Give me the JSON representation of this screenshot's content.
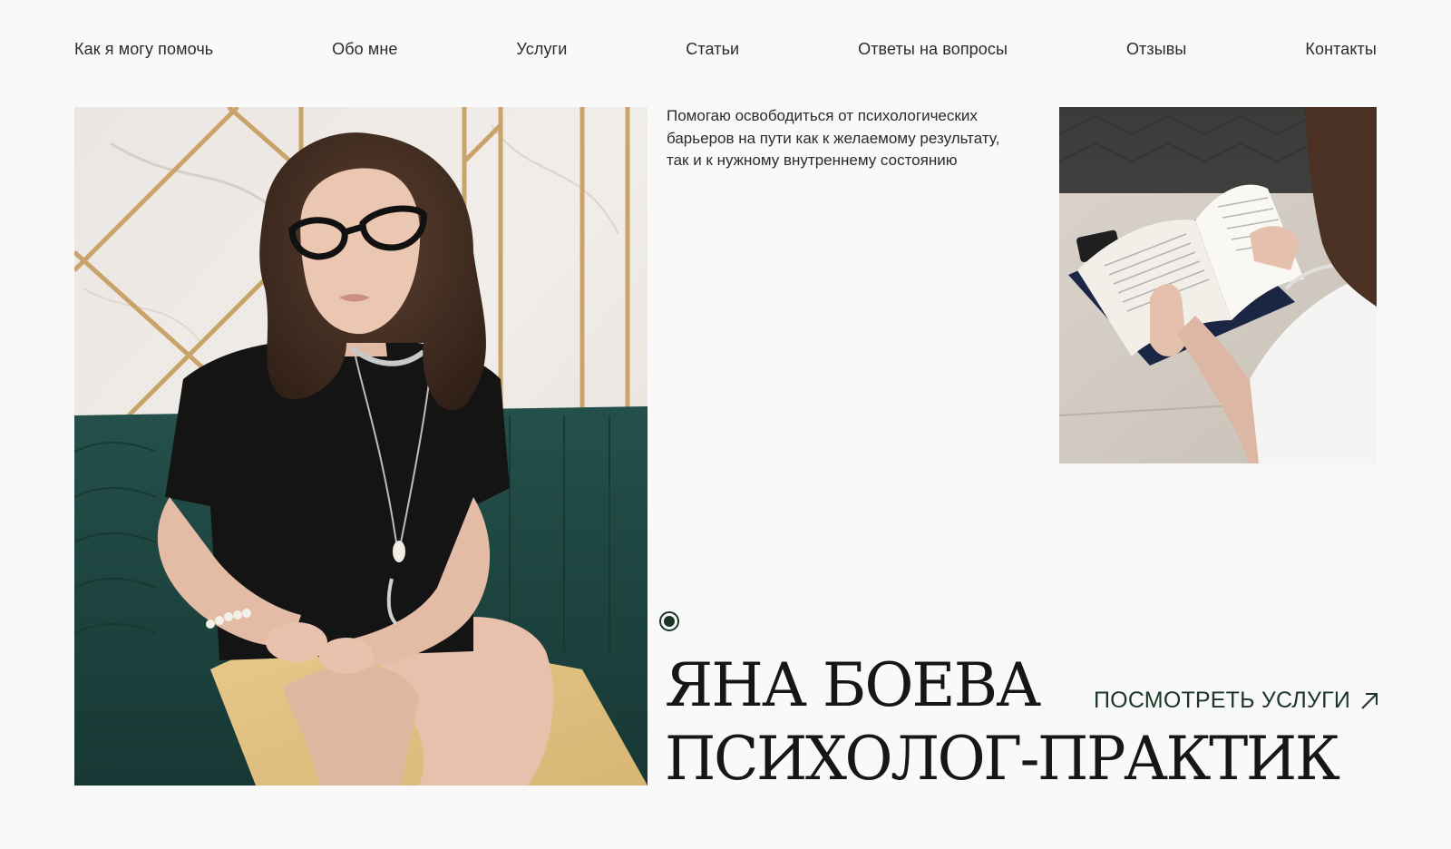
{
  "nav": {
    "items": [
      {
        "label": "Как я могу помочь"
      },
      {
        "label": "Обо мне"
      },
      {
        "label": "Услуги"
      },
      {
        "label": "Статьи"
      },
      {
        "label": "Ответы на вопросы"
      },
      {
        "label": "Отзывы"
      },
      {
        "label": "Контакты"
      }
    ]
  },
  "hero": {
    "tagline_lines": [
      "Помогаю освободиться от психологических",
      "барьеров на пути как к желаемому результату,",
      "так и к нужному внутреннему состоянию"
    ],
    "name": "ЯНА БОЕВА",
    "title": "ПСИХОЛОГ-ПРАКТИК",
    "cta_label": "ПОСМОТРЕТЬ УСЛУГИ",
    "cta_icon": "arrow-up-right-icon"
  },
  "colors": {
    "background": "#f9f9f9",
    "accent": "#1d3527",
    "text": "#1e1e1e",
    "sofa": "#1f4340"
  }
}
